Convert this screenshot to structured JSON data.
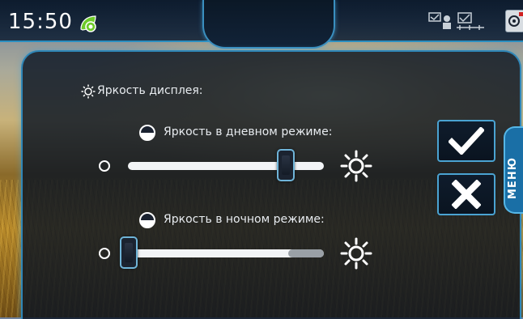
{
  "status_bar": {
    "time": "15:50",
    "icons": [
      "leaf-icon",
      "network-icon",
      "camera-icon"
    ]
  },
  "brightness": {
    "section_title": "Яркость дисплея:",
    "day": {
      "label": "Яркость в дневном режиме:",
      "level": 0.81
    },
    "night": {
      "label": "Яркость в ночном режиме:",
      "level": 0.0
    }
  },
  "actions": {
    "confirm_icon": "check-icon",
    "cancel_icon": "close-icon"
  },
  "menu_tab": {
    "label": "МЕНЮ"
  },
  "colors": {
    "accent": "#2f86b7",
    "leaf": "#6ecb2a"
  }
}
